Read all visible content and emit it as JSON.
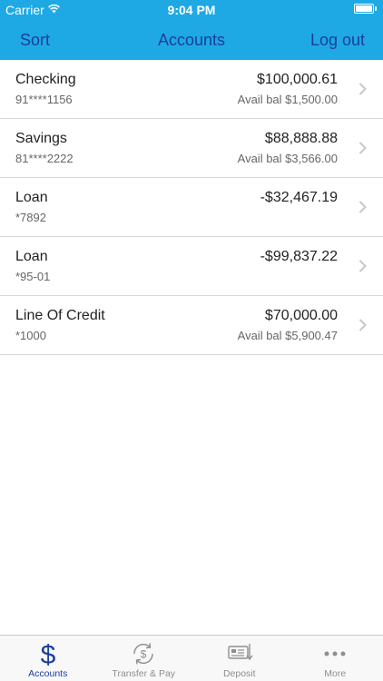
{
  "status": {
    "carrier": "Carrier",
    "time": "9:04 PM"
  },
  "nav": {
    "left": "Sort",
    "title": "Accounts",
    "right": "Log out"
  },
  "accounts": [
    {
      "name": "Checking",
      "number": "91****1156",
      "balance": "$100,000.61",
      "avail": "Avail bal $1,500.00"
    },
    {
      "name": "Savings",
      "number": "81****2222",
      "balance": "$88,888.88",
      "avail": "Avail bal $3,566.00"
    },
    {
      "name": "Loan",
      "number": "*7892",
      "balance": "-$32,467.19",
      "avail": ""
    },
    {
      "name": "Loan",
      "number": "*95-01",
      "balance": "-$99,837.22",
      "avail": ""
    },
    {
      "name": "Line Of Credit",
      "number": "*1000",
      "balance": "$70,000.00",
      "avail": "Avail bal $5,900.47"
    }
  ],
  "tabs": [
    {
      "label": "Accounts",
      "icon": "dollar-icon",
      "active": true
    },
    {
      "label": "Transfer & Pay",
      "icon": "transfer-icon",
      "active": false
    },
    {
      "label": "Deposit",
      "icon": "deposit-check-icon",
      "active": false
    },
    {
      "label": "More",
      "icon": "more-icon",
      "active": false
    }
  ],
  "colors": {
    "header": "#1ea9e5",
    "accent": "#1a3e9e",
    "inactive": "#8e8e93"
  }
}
